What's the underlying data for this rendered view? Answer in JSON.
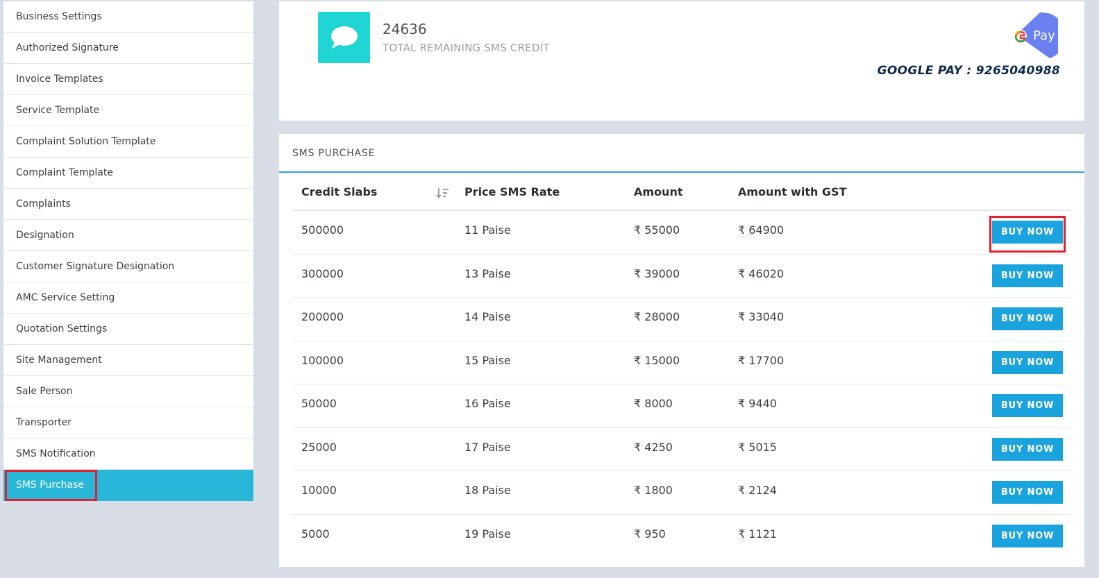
{
  "sidebar": {
    "items": [
      {
        "label": "Business Settings"
      },
      {
        "label": "Authorized Signature"
      },
      {
        "label": "Invoice Templates"
      },
      {
        "label": "Service Template"
      },
      {
        "label": "Complaint Solution Template"
      },
      {
        "label": "Complaint Template"
      },
      {
        "label": "Complaints"
      },
      {
        "label": "Designation"
      },
      {
        "label": "Customer Signature Designation"
      },
      {
        "label": "AMC Service Setting"
      },
      {
        "label": "Quotation Settings"
      },
      {
        "label": "Site Management"
      },
      {
        "label": "Sale Person"
      },
      {
        "label": "Transporter"
      },
      {
        "label": "SMS Notification"
      },
      {
        "label": "SMS Purchase",
        "active": true
      }
    ]
  },
  "credit": {
    "count": "24636",
    "label": "TOTAL REMAINING SMS CREDIT"
  },
  "payment": {
    "logo_text": "Pay",
    "text": "GOOGLE PAY : 9265040988"
  },
  "purchase": {
    "title": "SMS PURCHASE",
    "columns": [
      "Credit Slabs",
      "Price SMS Rate",
      "Amount",
      "Amount with GST"
    ],
    "button_label": "BUY NOW",
    "rows": [
      {
        "credits": "500000",
        "rate": "11 Paise",
        "amount": "₹ 55000",
        "amount_gst": "₹ 64900"
      },
      {
        "credits": "300000",
        "rate": "13 Paise",
        "amount": "₹ 39000",
        "amount_gst": "₹ 46020"
      },
      {
        "credits": "200000",
        "rate": "14 Paise",
        "amount": "₹ 28000",
        "amount_gst": "₹ 33040"
      },
      {
        "credits": "100000",
        "rate": "15 Paise",
        "amount": "₹ 15000",
        "amount_gst": "₹ 17700"
      },
      {
        "credits": "50000",
        "rate": "16 Paise",
        "amount": "₹ 8000",
        "amount_gst": "₹ 9440"
      },
      {
        "credits": "25000",
        "rate": "17 Paise",
        "amount": "₹ 4250",
        "amount_gst": "₹ 5015"
      },
      {
        "credits": "10000",
        "rate": "18 Paise",
        "amount": "₹ 1800",
        "amount_gst": "₹ 2124"
      },
      {
        "credits": "5000",
        "rate": "19 Paise",
        "amount": "₹ 950",
        "amount_gst": "₹ 1121"
      }
    ]
  },
  "colors": {
    "accent": "#28b6d9",
    "button": "#1aa3dc",
    "sms_tile": "#1fd6d4",
    "highlight": "#e0202c"
  }
}
